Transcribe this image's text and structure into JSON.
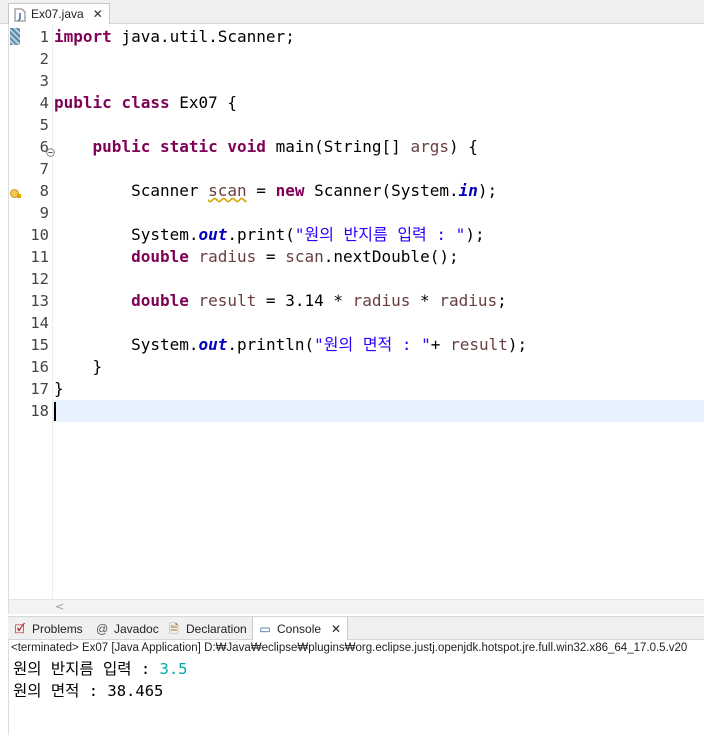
{
  "editor": {
    "tab": {
      "title": "Ex07.java",
      "close": "✕"
    },
    "lines": [
      {
        "n": "1",
        "segs": [
          {
            "t": "import",
            "c": "kw"
          },
          {
            "t": " java.util.Scanner;"
          }
        ]
      },
      {
        "n": "2",
        "segs": []
      },
      {
        "n": "3",
        "segs": []
      },
      {
        "n": "4",
        "segs": [
          {
            "t": "public",
            "c": "kw"
          },
          {
            "t": " "
          },
          {
            "t": "class",
            "c": "kw"
          },
          {
            "t": " Ex07 {"
          }
        ]
      },
      {
        "n": "5",
        "segs": []
      },
      {
        "n": "6",
        "segs": [
          {
            "t": "    "
          },
          {
            "t": "public",
            "c": "kw"
          },
          {
            "t": " "
          },
          {
            "t": "static",
            "c": "kw"
          },
          {
            "t": " "
          },
          {
            "t": "void",
            "c": "kw"
          },
          {
            "t": " main(String[] "
          },
          {
            "t": "args",
            "c": "loc"
          },
          {
            "t": ") {"
          }
        ]
      },
      {
        "n": "7",
        "segs": []
      },
      {
        "n": "8",
        "segs": [
          {
            "t": "        Scanner "
          },
          {
            "t": "scan",
            "c": "loc warn-ul"
          },
          {
            "t": " = "
          },
          {
            "t": "new",
            "c": "kw"
          },
          {
            "t": " Scanner(System."
          },
          {
            "t": "in",
            "c": "fld"
          },
          {
            "t": ");"
          }
        ]
      },
      {
        "n": "9",
        "segs": []
      },
      {
        "n": "10",
        "segs": [
          {
            "t": "        System."
          },
          {
            "t": "out",
            "c": "fld"
          },
          {
            "t": ".print("
          },
          {
            "t": "\"원의 반지름 입력 : \"",
            "c": "str"
          },
          {
            "t": ");"
          }
        ]
      },
      {
        "n": "11",
        "segs": [
          {
            "t": "        "
          },
          {
            "t": "double",
            "c": "kw"
          },
          {
            "t": " "
          },
          {
            "t": "radius",
            "c": "loc"
          },
          {
            "t": " = "
          },
          {
            "t": "scan",
            "c": "loc"
          },
          {
            "t": ".nextDouble();"
          }
        ]
      },
      {
        "n": "12",
        "segs": []
      },
      {
        "n": "13",
        "segs": [
          {
            "t": "        "
          },
          {
            "t": "double",
            "c": "kw"
          },
          {
            "t": " "
          },
          {
            "t": "result",
            "c": "loc"
          },
          {
            "t": " = 3.14 * "
          },
          {
            "t": "radius",
            "c": "loc"
          },
          {
            "t": " * "
          },
          {
            "t": "radius",
            "c": "loc"
          },
          {
            "t": ";"
          }
        ]
      },
      {
        "n": "14",
        "segs": []
      },
      {
        "n": "15",
        "segs": [
          {
            "t": "        System."
          },
          {
            "t": "out",
            "c": "fld"
          },
          {
            "t": ".println("
          },
          {
            "t": "\"원의 면적 : \"",
            "c": "str"
          },
          {
            "t": "+ "
          },
          {
            "t": "result",
            "c": "loc"
          },
          {
            "t": ");"
          }
        ]
      },
      {
        "n": "16",
        "segs": [
          {
            "t": "    }"
          }
        ]
      },
      {
        "n": "17",
        "segs": [
          {
            "t": "}"
          }
        ]
      },
      {
        "n": "18",
        "segs": []
      }
    ],
    "colors": {
      "keyword": "#7f0055",
      "string": "#2a00ff",
      "field": "#0000c0",
      "local": "#6a3e3e",
      "current_line": "#e8f2fe"
    },
    "scroll_left_glyph": "<"
  },
  "views": {
    "tabs": [
      {
        "label": "Problems",
        "icon": "problems-icon",
        "glyph": "🗹"
      },
      {
        "label": "Javadoc",
        "icon": "at-icon",
        "glyph": "@"
      },
      {
        "label": "Declaration",
        "icon": "declaration-icon",
        "glyph": "🗎"
      },
      {
        "label": "Console",
        "icon": "console-icon",
        "glyph": "▭",
        "active": true
      }
    ],
    "console_close": "✕"
  },
  "console": {
    "status": "<terminated> Ex07 [Java Application] D:₩Java₩eclipse₩plugins₩org.eclipse.justj.openjdk.hotspot.jre.full.win32.x86_64_17.0.5.v20",
    "line1_prompt": "원의 반지름 입력 : ",
    "line1_input": "3.5",
    "line2": "원의 면적 : 38.465",
    "input_color": "#00a8a8"
  }
}
